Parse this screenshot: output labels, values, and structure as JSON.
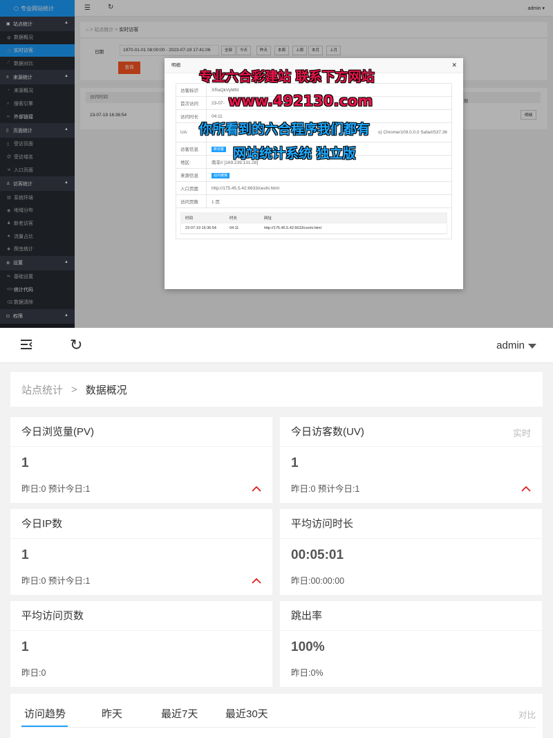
{
  "top": {
    "logo": "专业网站统计",
    "user": "admin",
    "sidebar": [
      {
        "type": "group",
        "label": "站点统计",
        "icon": "home-icon"
      },
      {
        "type": "item",
        "label": "数据概况",
        "icon": "dashboard-icon"
      },
      {
        "type": "item",
        "label": "实时访客",
        "icon": "clock-icon",
        "active": true
      },
      {
        "type": "item",
        "label": "数据对比",
        "icon": "compare-icon"
      },
      {
        "type": "group",
        "label": "来源统计",
        "icon": "menu-icon"
      },
      {
        "type": "item",
        "label": "来源概况",
        "icon": "gauge-icon"
      },
      {
        "type": "item",
        "label": "搜索引擎",
        "icon": "search-icon"
      },
      {
        "type": "item",
        "label": "外部链接",
        "icon": "link-icon",
        "bold": true
      },
      {
        "type": "group",
        "label": "页面统计",
        "icon": "file-icon"
      },
      {
        "type": "item",
        "label": "受访页面",
        "icon": "file-icon"
      },
      {
        "type": "item",
        "label": "受访域名",
        "icon": "at-icon"
      },
      {
        "type": "item",
        "label": "入口页面",
        "icon": "entry-icon"
      },
      {
        "type": "group",
        "label": "访客统计",
        "icon": "user-icon"
      },
      {
        "type": "item",
        "label": "系统环境",
        "icon": "chart-icon"
      },
      {
        "type": "item",
        "label": "地域分布",
        "icon": "location-icon"
      },
      {
        "type": "item",
        "label": "新老访客",
        "icon": "users-icon"
      },
      {
        "type": "item",
        "label": "流量占比",
        "icon": "star-icon"
      },
      {
        "type": "item",
        "label": "爬虫统计",
        "icon": "bug-icon"
      },
      {
        "type": "group",
        "label": "设置",
        "icon": "gear-icon"
      },
      {
        "type": "item",
        "label": "基础设置",
        "icon": "sliders-icon"
      },
      {
        "type": "item",
        "label": "统计代码",
        "icon": "code-icon",
        "bold": true
      },
      {
        "type": "item",
        "label": "数据清除",
        "icon": "trash-icon"
      },
      {
        "type": "group",
        "label": "权限",
        "icon": "lock-icon"
      }
    ],
    "crumb": {
      "root": "站点统计",
      "current": "实时访客"
    },
    "filter": {
      "label": "日期",
      "date": "1970-01-01 08:00:00 - 2023-07-19 17:41:06",
      "quick": [
        "全部",
        "今天",
        "昨天",
        "本周",
        "上周",
        "本月",
        "上月"
      ],
      "query": "查询"
    },
    "table": {
      "col1": "访问时间",
      "col_last": "数",
      "row_time": "23-07-19 16:36:54",
      "detail": "明细"
    },
    "modal": {
      "title": "明细",
      "rows": [
        {
          "k": "访客标识",
          "v": "XRaQkVyMfd"
        },
        {
          "k": "首次访问",
          "v": "23-07-"
        },
        {
          "k": "访问时长",
          "v": "04:11"
        },
        {
          "k": "UA:",
          "v": "o) Chrome/109.0.0.0 Safari/537.36"
        },
        {
          "k": "访客信息",
          "tag": "新访客"
        },
        {
          "k": "地区:",
          "v": "南非// [169.239.131.28]"
        },
        {
          "k": "来源信息",
          "tag": "站内链接"
        },
        {
          "k": "入口页面",
          "v": "http://175.45.5.42:6633/ceshi.html"
        },
        {
          "k": "访问页数",
          "v": "1 页"
        }
      ],
      "mini_head": [
        "时间",
        "时长",
        "网址"
      ],
      "mini_row": [
        "23-07-19 16:36:54",
        "04:11",
        "http://175.45.5.42:6633/ceshi.html"
      ]
    },
    "watermark": {
      "line1": "专业六合彩建站 联系下方网站",
      "line2": "www.492130.com",
      "line3": "你所看到的六合程序我们都有",
      "line4": "网站统计系统 独立版"
    }
  },
  "bottom": {
    "user": "admin",
    "crumb": {
      "root": "站点统计",
      "sep": ">",
      "current": "数据概况"
    },
    "cards": [
      {
        "title": "今日浏览量(PV)",
        "value": "1",
        "sub": "昨日:0 预计今日:1",
        "up": true
      },
      {
        "title": "今日访客数(UV)",
        "right": "实时",
        "value": "1",
        "sub": "昨日:0 预计今日:1",
        "up": true
      },
      {
        "title": "今日IP数",
        "value": "1",
        "sub": "昨日:0 预计今日:1",
        "up": true
      },
      {
        "title": "平均访问时长",
        "value": "00:05:01",
        "sub": "昨日:00:00:00",
        "up": false
      },
      {
        "title": "平均访问页数",
        "value": "1",
        "sub": "昨日:0",
        "up": false
      },
      {
        "title": "跳出率",
        "value": "100%",
        "sub": "昨日:0%",
        "up": false
      }
    ],
    "tabs": [
      "访问趋势",
      "昨天",
      "最近7天",
      "最近30天"
    ],
    "compare": "对比"
  }
}
